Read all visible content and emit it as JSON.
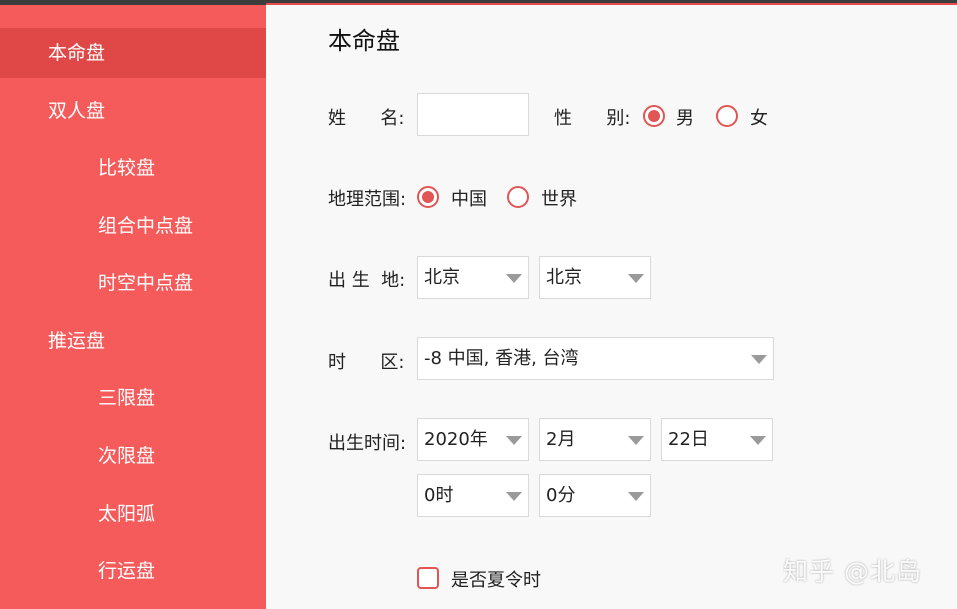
{
  "sidebar": {
    "items": [
      {
        "label": "本命盘",
        "level": 1,
        "active": true
      },
      {
        "label": "双人盘",
        "level": 1
      },
      {
        "label": "比较盘",
        "level": 2
      },
      {
        "label": "组合中点盘",
        "level": 2
      },
      {
        "label": "时空中点盘",
        "level": 2
      },
      {
        "label": "推运盘",
        "level": 1
      },
      {
        "label": "三限盘",
        "level": 2
      },
      {
        "label": "次限盘",
        "level": 2
      },
      {
        "label": "太阳弧",
        "level": 2
      },
      {
        "label": "行运盘",
        "level": 2
      }
    ]
  },
  "form": {
    "title": "本命盘",
    "name_label": "姓      名:",
    "name_value": "",
    "gender_label": "性      别:",
    "gender_options": [
      "男",
      "女"
    ],
    "gender_selected": "男",
    "region_label": "地理范围:",
    "region_options": [
      "中国",
      "世界"
    ],
    "region_selected": "中国",
    "birthplace_label": "出 生  地:",
    "province": "北京",
    "city": "北京",
    "timezone_label": "时      区:",
    "timezone": "-8 中国, 香港, 台湾",
    "birthtime_label": "出生时间:",
    "year": "2020年",
    "month": "2月",
    "day": "22日",
    "hour": "0时",
    "minute": "0分",
    "dst_label": "是否夏令时",
    "dst_checked": false
  },
  "watermark": "知乎 @北岛",
  "colors": {
    "sidebar": "#f55b5b",
    "sidebar_active": "#e04848",
    "accent": "#e25555"
  }
}
